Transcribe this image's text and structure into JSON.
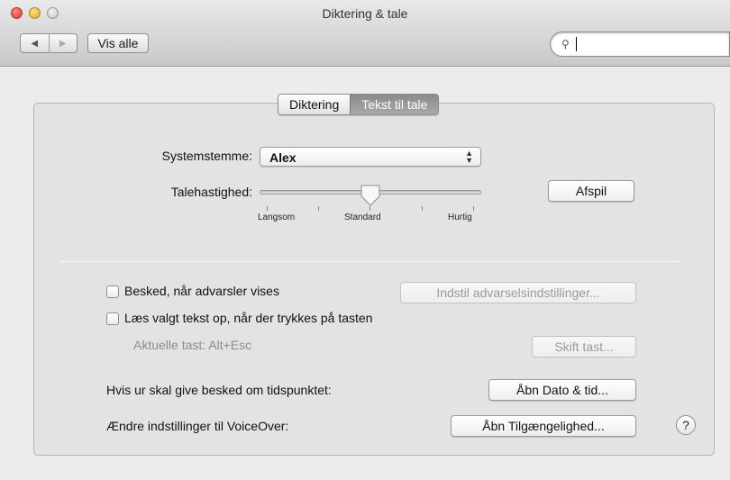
{
  "window": {
    "title": "Diktering & tale"
  },
  "toolbar": {
    "back_icon": "back-arrow-icon",
    "forward_icon": "forward-arrow-icon",
    "show_all_label": "Vis alle",
    "search_value": ""
  },
  "tabs": [
    {
      "label": "Diktering",
      "selected": false
    },
    {
      "label": "Tekst til tale",
      "selected": true
    }
  ],
  "voice": {
    "label": "Systemstemme:",
    "selected": "Alex"
  },
  "rate": {
    "label": "Talehastighed:",
    "ticks": [
      "Langsom",
      "Standard",
      "Hurtig"
    ],
    "value_fraction": 0.5,
    "play_label": "Afspil"
  },
  "options": {
    "alert_checkbox_label": "Besked, når advarsler vises",
    "alert_checked": false,
    "alert_settings_button": "Indstil advarselsindstillinger...",
    "read_checkbox_label": "Læs valgt tekst op, når der trykkes på tasten",
    "read_checked": false,
    "current_key_label": "Aktuelle tast: Alt+Esc",
    "change_key_button": "Skift tast...",
    "clock_label": "Hvis ur skal give besked om tidspunktet:",
    "clock_button": "Åbn Dato & tid...",
    "voiceover_label": "Ændre indstillinger til VoiceOver:",
    "voiceover_button": "Åbn Tilgængelighed...",
    "help_label": "?"
  },
  "colors": {
    "active_tab": "#9a9a9a",
    "disabled_text": "#9a9a9a"
  }
}
